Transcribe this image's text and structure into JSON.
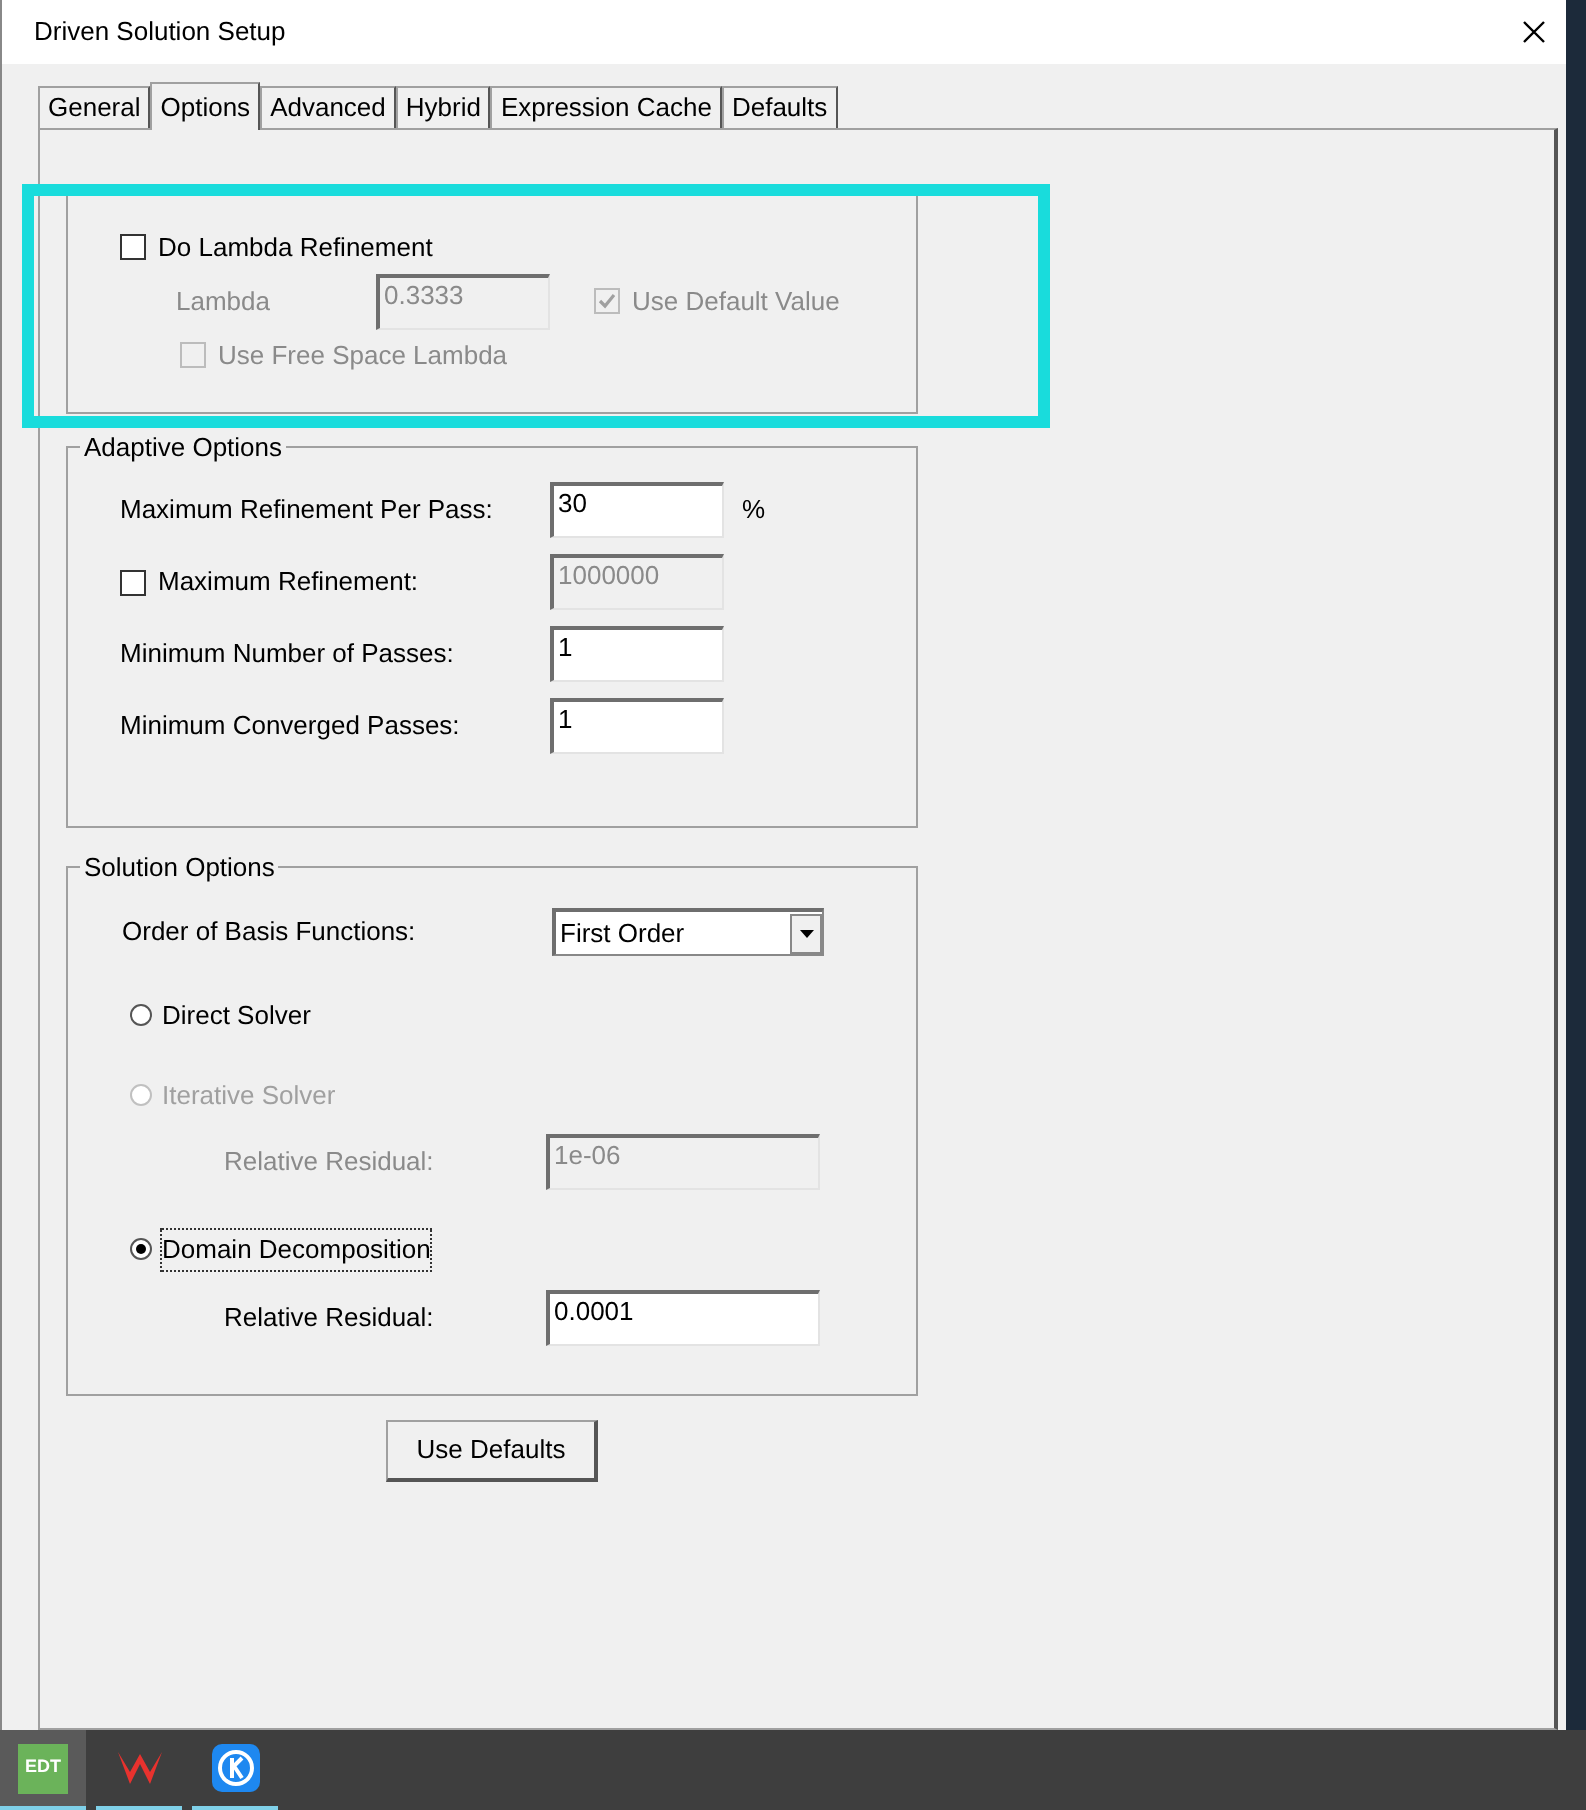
{
  "window": {
    "title": "Driven Solution Setup"
  },
  "tabs": [
    {
      "label": "General",
      "selected": false
    },
    {
      "label": "Options",
      "selected": true
    },
    {
      "label": "Advanced",
      "selected": false
    },
    {
      "label": "Hybrid",
      "selected": false
    },
    {
      "label": "Expression Cache",
      "selected": false
    },
    {
      "label": "Defaults",
      "selected": false
    }
  ],
  "initial_mesh": {
    "refinement": {
      "label": "Do Lambda Refinement",
      "checked": false
    },
    "lambda": {
      "label": "Lambda",
      "value": "0.3333",
      "disabled": true
    },
    "use_default": {
      "label": "Use Default Value",
      "checked": true,
      "disabled": true
    },
    "free_space": {
      "label": "Use Free Space Lambda",
      "checked": false,
      "disabled": true
    }
  },
  "adaptive": {
    "title": "Adaptive Options",
    "rows": [
      {
        "kind": "field",
        "label": "Maximum Refinement Per Pass:",
        "value": "30",
        "unit": "%",
        "disabled": false
      },
      {
        "kind": "checkbox",
        "label": "Maximum Refinement:",
        "checked": false,
        "value": "1000000",
        "disabled": true
      },
      {
        "kind": "field",
        "label": "Minimum Number of Passes:",
        "value": "1",
        "disabled": false
      },
      {
        "kind": "field",
        "label": "Minimum Converged Passes:",
        "value": "1",
        "disabled": false
      }
    ]
  },
  "solution": {
    "title": "Solution Options",
    "basis": {
      "label": "Order of Basis Functions:",
      "value": "First Order"
    },
    "solvers": [
      {
        "label": "Direct Solver",
        "selected": false,
        "disabled": false
      },
      {
        "label": "Iterative Solver",
        "selected": false,
        "disabled": true,
        "residual": {
          "label": "Relative Residual:",
          "value": "1e-06",
          "disabled": true
        }
      },
      {
        "label": "Domain Decomposition",
        "selected": true,
        "disabled": false,
        "residual": {
          "label": "Relative Residual:",
          "value": "0.0001",
          "disabled": false
        }
      }
    ]
  },
  "button": "Use Defaults",
  "taskbar": [
    {
      "kind": "edt",
      "label": "EDT",
      "selected": true
    },
    {
      "kind": "wps",
      "selected": false
    },
    {
      "kind": "k",
      "selected": false
    }
  ]
}
